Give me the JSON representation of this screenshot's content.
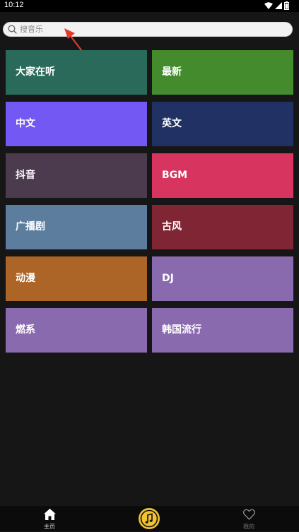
{
  "status_bar": {
    "time": "10:12",
    "icons": [
      "wifi-icon",
      "signal-icon",
      "battery-icon"
    ]
  },
  "search": {
    "placeholder": "搜音乐",
    "icon": "search-icon"
  },
  "annotation": {
    "type": "arrow",
    "color": "#e53a2b"
  },
  "categories": [
    {
      "label": "大家在听",
      "color": "#2a6a5a"
    },
    {
      "label": "最新",
      "color": "#448b2e"
    },
    {
      "label": "中文",
      "color": "#7358f3"
    },
    {
      "label": "英文",
      "color": "#223163"
    },
    {
      "label": "抖音",
      "color": "#4c3a4e"
    },
    {
      "label": "BGM",
      "color": "#d7355f"
    },
    {
      "label": "广播剧",
      "color": "#5d7d9f"
    },
    {
      "label": "古风",
      "color": "#7f2534"
    },
    {
      "label": "动漫",
      "color": "#ad6427"
    },
    {
      "label": "DJ",
      "color": "#8a6aae"
    },
    {
      "label": "燃系",
      "color": "#8a6aae"
    },
    {
      "label": "韩国流行",
      "color": "#8a6aae"
    }
  ],
  "bottom_nav": {
    "home": {
      "label": "主页",
      "icon": "home-icon"
    },
    "player": {
      "icon": "music-note-icon",
      "color": "#f2c232"
    },
    "mine": {
      "label": "我的",
      "icon": "heart-icon"
    }
  }
}
